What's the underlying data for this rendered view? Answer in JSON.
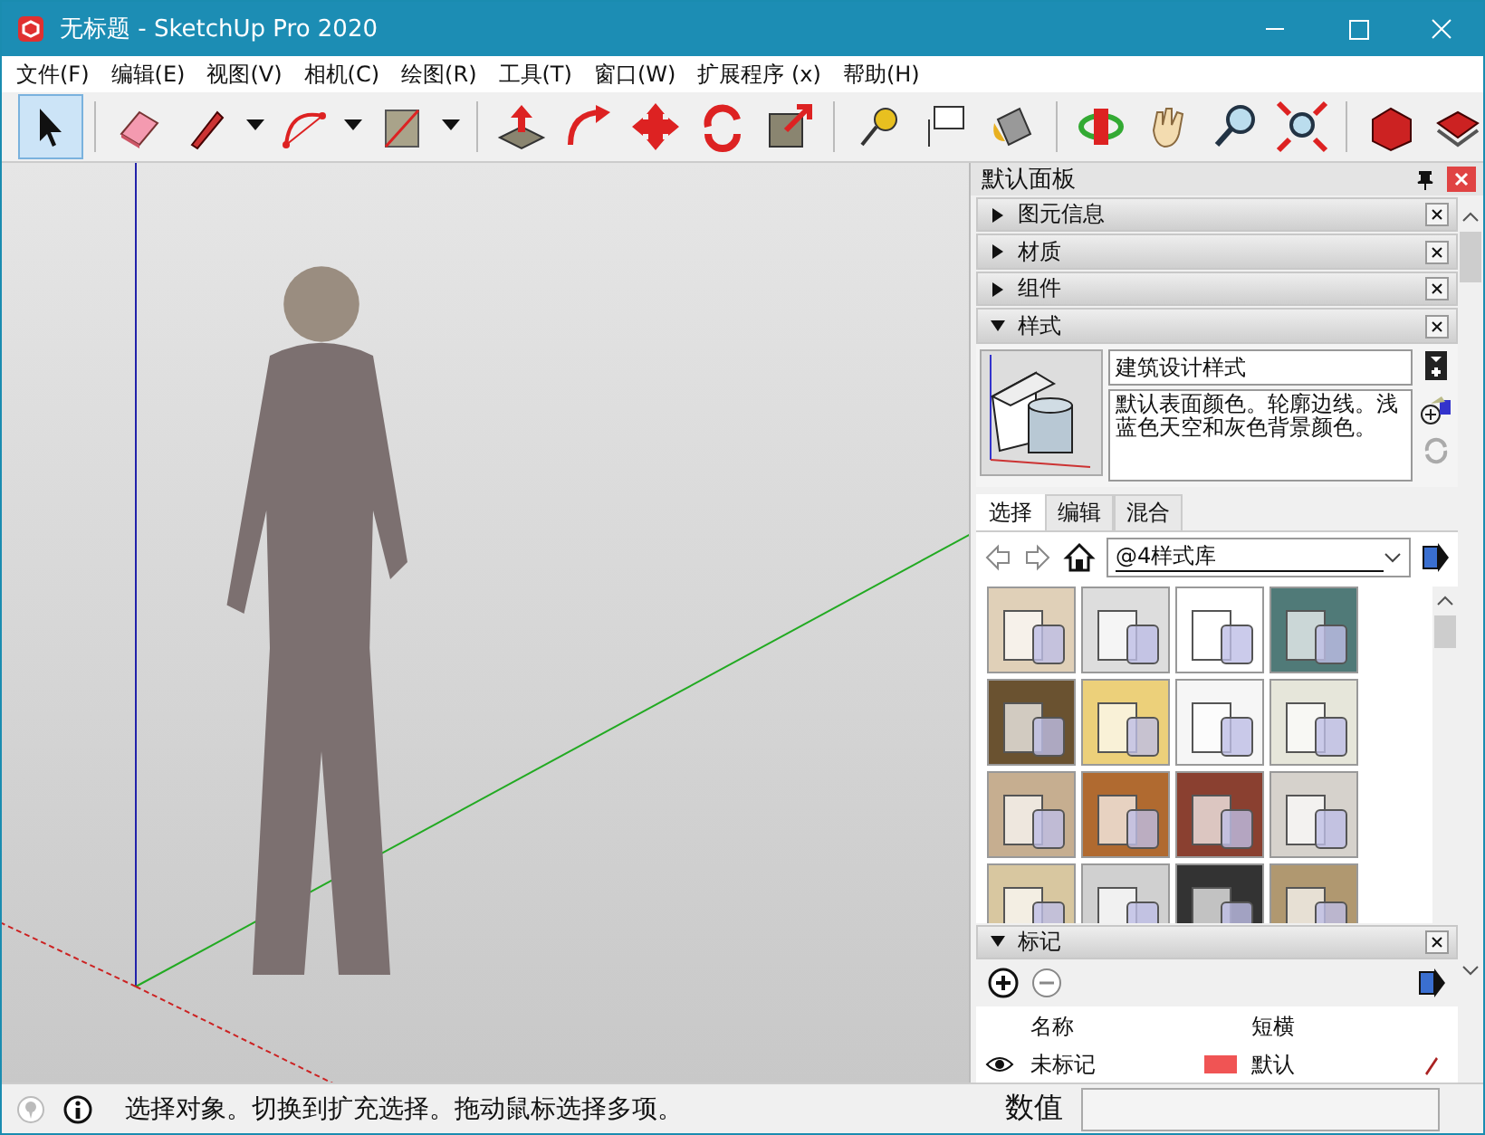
{
  "window": {
    "title": "无标题 - SketchUp Pro 2020"
  },
  "menu": [
    "文件(F)",
    "编辑(E)",
    "视图(V)",
    "相机(C)",
    "绘图(R)",
    "工具(T)",
    "窗口(W)",
    "扩展程序 (x)",
    "帮助(H)"
  ],
  "toolbar": {
    "select_tool_selected": true
  },
  "tray": {
    "title": "默认面板",
    "sections": [
      {
        "title": "图元信息",
        "expanded": false
      },
      {
        "title": "材质",
        "expanded": false
      },
      {
        "title": "组件",
        "expanded": false
      },
      {
        "title": "样式",
        "expanded": true
      }
    ],
    "style": {
      "name": "建筑设计样式",
      "description": "默认表面颜色。轮廓边线。浅蓝色天空和灰色背景颜色。",
      "tabs": [
        {
          "label": "选择",
          "selected": true
        },
        {
          "label": "编辑",
          "selected": false
        },
        {
          "label": "混合",
          "selected": false
        }
      ],
      "library": "@4样式库"
    },
    "tags": {
      "title": "标记",
      "expanded": true,
      "columns": [
        "名称",
        "短横"
      ],
      "rows": [
        {
          "name": "未标记",
          "color": "#f05454",
          "dash": "默认",
          "visible": true
        }
      ]
    }
  },
  "status_bar": {
    "message": "选择对象。切换到扩充选择。拖动鼠标选择多项。",
    "measurements_label": "数值"
  }
}
